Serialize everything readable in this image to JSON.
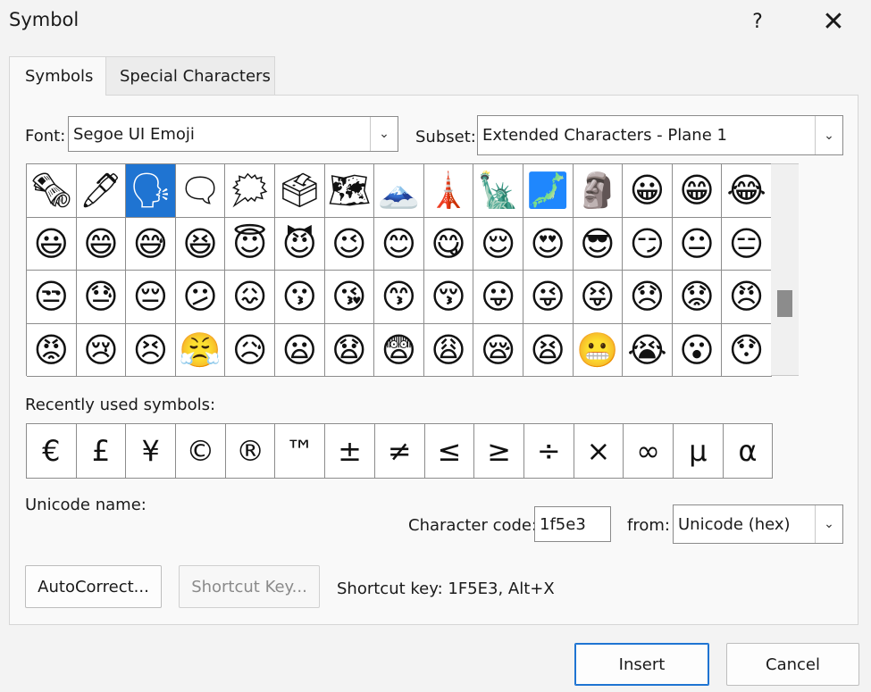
{
  "dialog": {
    "title": "Symbol",
    "help_glyph": "?",
    "close_glyph": "✕"
  },
  "tabs": [
    {
      "label": "Symbols",
      "active": true
    },
    {
      "label": "Special Characters",
      "active": false
    }
  ],
  "font": {
    "label": "Font:",
    "value": "Segoe UI Emoji"
  },
  "subset": {
    "label": "Subset:",
    "value": "Extended Characters - Plane 1"
  },
  "symbol_grid": {
    "selected_index": 2,
    "cells": [
      "🗞",
      "🖊",
      "🗣",
      "🗨",
      "🗯",
      "🗳",
      "🗺",
      "🗻",
      "🗼",
      "🗽",
      "🗾",
      "🗿",
      "😀",
      "😁",
      "😂",
      "😃",
      "😄",
      "😅",
      "😆",
      "😇",
      "😈",
      "😉",
      "😊",
      "😋",
      "😌",
      "😍",
      "😎",
      "😏",
      "😐",
      "😑",
      "😒",
      "😓",
      "😔",
      "😕",
      "😖",
      "😗",
      "😘",
      "😙",
      "😚",
      "😛",
      "😜",
      "😝",
      "😞",
      "😟",
      "😠",
      "😡",
      "😢",
      "😣",
      "😤",
      "😥",
      "😦",
      "😧",
      "😨",
      "😩",
      "😪",
      "😫",
      "😬",
      "😭",
      "😮",
      "😯"
    ]
  },
  "recent": {
    "label": "Recently used symbols:",
    "symbols": [
      "€",
      "£",
      "¥",
      "©",
      "®",
      "™",
      "±",
      "≠",
      "≤",
      "≥",
      "÷",
      "×",
      "∞",
      "µ",
      "α"
    ]
  },
  "unicode_name": {
    "label": "Unicode name:"
  },
  "character_code": {
    "label": "Character code:",
    "value": "1f5e3"
  },
  "from": {
    "label": "from:",
    "value": "Unicode (hex)"
  },
  "buttons": {
    "autocorrect": "AutoCorrect...",
    "shortcut_key": "Shortcut Key...",
    "insert": "Insert",
    "cancel": "Cancel"
  },
  "shortcut_text": "Shortcut key: 1F5E3, Alt+X",
  "icons": {
    "dropdown": "chevron-down-icon",
    "scroll_thumb": "scroll-thumb"
  },
  "colors": {
    "selected": "#1f74d2",
    "background": "#f3f3f3"
  }
}
